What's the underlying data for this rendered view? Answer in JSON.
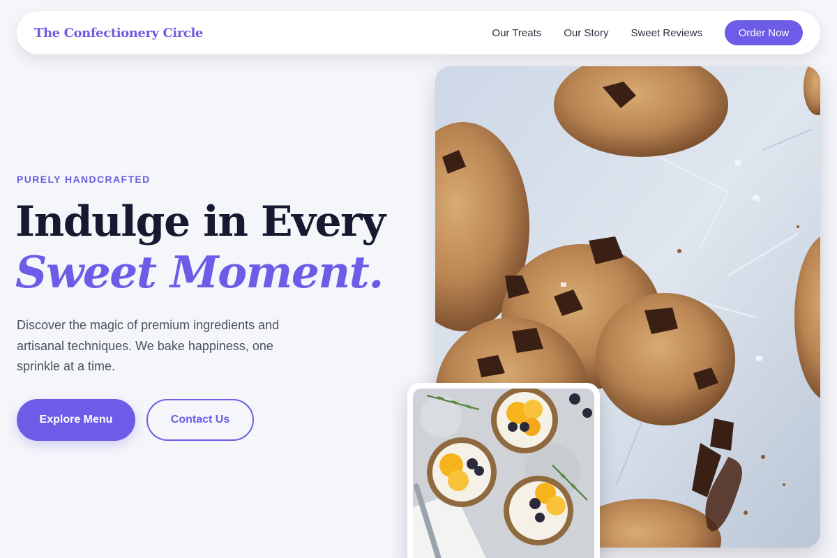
{
  "brand": {
    "name": "The Confectionery Circle"
  },
  "nav": {
    "links": [
      {
        "label": "Our Treats"
      },
      {
        "label": "Our Story"
      },
      {
        "label": "Sweet Reviews"
      }
    ],
    "cta_label": "Order Now"
  },
  "hero": {
    "eyebrow": "PURELY HANDCRAFTED",
    "headline_line1": "Indulge in Every",
    "headline_line2": "Sweet Moment.",
    "lead": "Discover the magic of premium ingredients and artisanal techniques. We bake happiness, one sprinkle at a time.",
    "primary_cta": "Explore Menu",
    "secondary_cta": "Contact Us"
  },
  "images": {
    "main": {
      "subject": "chocolate-chip-cookies-photo"
    },
    "secondary": {
      "subject": "fruit-tarts-photo"
    }
  },
  "colors": {
    "accent": "#6c5ce7",
    "heading": "#151a30",
    "body_text": "#4a5262",
    "page_bg": "#f5f6fa"
  }
}
